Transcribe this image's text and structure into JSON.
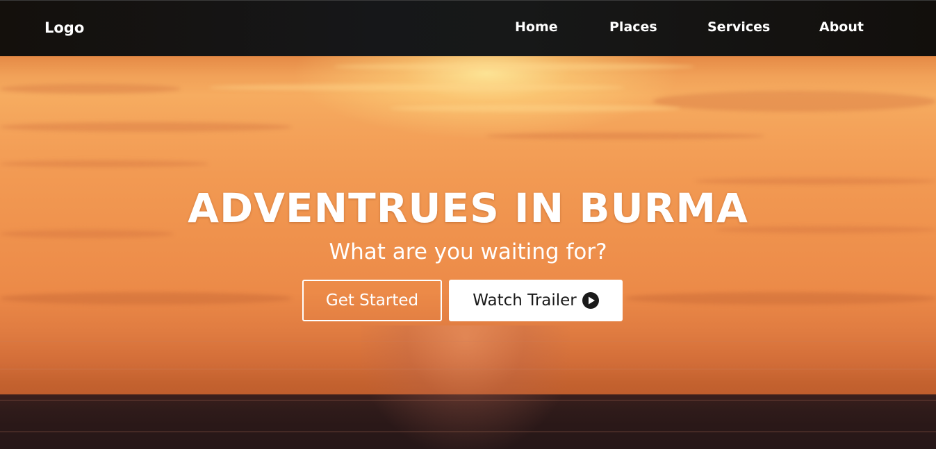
{
  "nav": {
    "logo": "Logo",
    "links": [
      {
        "label": "Home"
      },
      {
        "label": "Places"
      },
      {
        "label": "Services"
      },
      {
        "label": "About"
      }
    ]
  },
  "hero": {
    "title": "ADVENTRUES IN BURMA",
    "subtitle": "What are you waiting for?",
    "primary_button": "Get Started",
    "secondary_button": "Watch Trailer",
    "secondary_button_icon": "play-circle-icon"
  },
  "colors": {
    "navbar": "#161719",
    "sky": "#f29a53",
    "sea": "#2a1818",
    "button_text_dark": "#1a1a1a",
    "white": "#ffffff"
  }
}
